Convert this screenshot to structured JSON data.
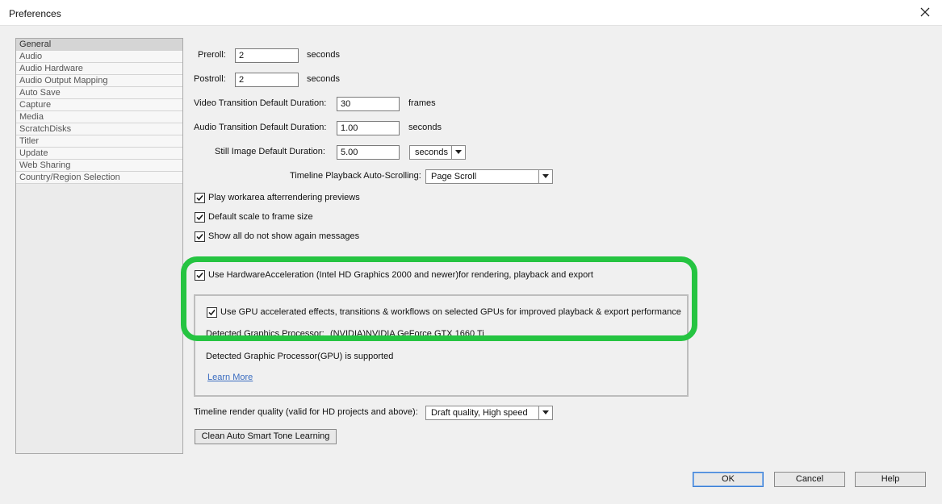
{
  "window": {
    "title": "Preferences"
  },
  "sidebar": {
    "items": [
      {
        "label": "General",
        "selected": true
      },
      {
        "label": "Audio"
      },
      {
        "label": "Audio Hardware"
      },
      {
        "label": "Audio Output Mapping"
      },
      {
        "label": "Auto Save"
      },
      {
        "label": "Capture"
      },
      {
        "label": "Media"
      },
      {
        "label": "ScratchDisks"
      },
      {
        "label": "Titler"
      },
      {
        "label": "Update"
      },
      {
        "label": "Web Sharing"
      },
      {
        "label": "Country/Region Selection"
      }
    ]
  },
  "general": {
    "preroll": {
      "label": "Preroll:",
      "value": "2",
      "unit": "seconds"
    },
    "postroll": {
      "label": "Postroll:",
      "value": "2",
      "unit": "seconds"
    },
    "video_transition": {
      "label": "Video Transition Default Duration:",
      "value": "30",
      "unit": "frames"
    },
    "audio_transition": {
      "label": "Audio Transition Default Duration:",
      "value": "1.00",
      "unit": "seconds"
    },
    "still_image": {
      "label": "Still Image Default Duration:",
      "value": "5.00",
      "unit_dropdown": "seconds"
    },
    "timeline_autoscroll": {
      "label": "Timeline Playback Auto-Scrolling:",
      "value": "Page Scroll"
    },
    "checkboxes": {
      "play_workarea": {
        "label": "Play workarea afterrendering previews",
        "checked": true
      },
      "default_scale": {
        "label": "Default scale to frame size",
        "checked": true
      },
      "show_all": {
        "label": "Show all do not show again messages",
        "checked": true
      },
      "hw_accel": {
        "label": "Use HardwareAcceleration (Intel HD Graphics 2000 and newer)for rendering, playback and export",
        "checked": true
      },
      "gpu_effects": {
        "label": "Use GPU accelerated effects, transitions & workflows on selected GPUs for improved playback & export performance",
        "checked": true
      }
    },
    "detected_processor": {
      "label": "Detected Graphics Processor:",
      "value": "(NVIDIA)NVIDIA GeForce GTX 1660 Ti"
    },
    "gpu_status": "Detected Graphic Processor(GPU) is supported",
    "learn_more": "Learn More",
    "render_quality": {
      "label": "Timeline render quality (valid for HD projects and above):",
      "value": "Draft quality, High speed"
    },
    "clean_button": "Clean Auto Smart Tone Learning"
  },
  "footer": {
    "ok": "OK",
    "cancel": "Cancel",
    "help": "Help"
  },
  "colors": {
    "highlight": "#25c441",
    "link": "#3a6cc0"
  },
  "icons": {
    "close": "close-icon",
    "check": "check-icon",
    "dropdown": "chevron-down-icon"
  }
}
